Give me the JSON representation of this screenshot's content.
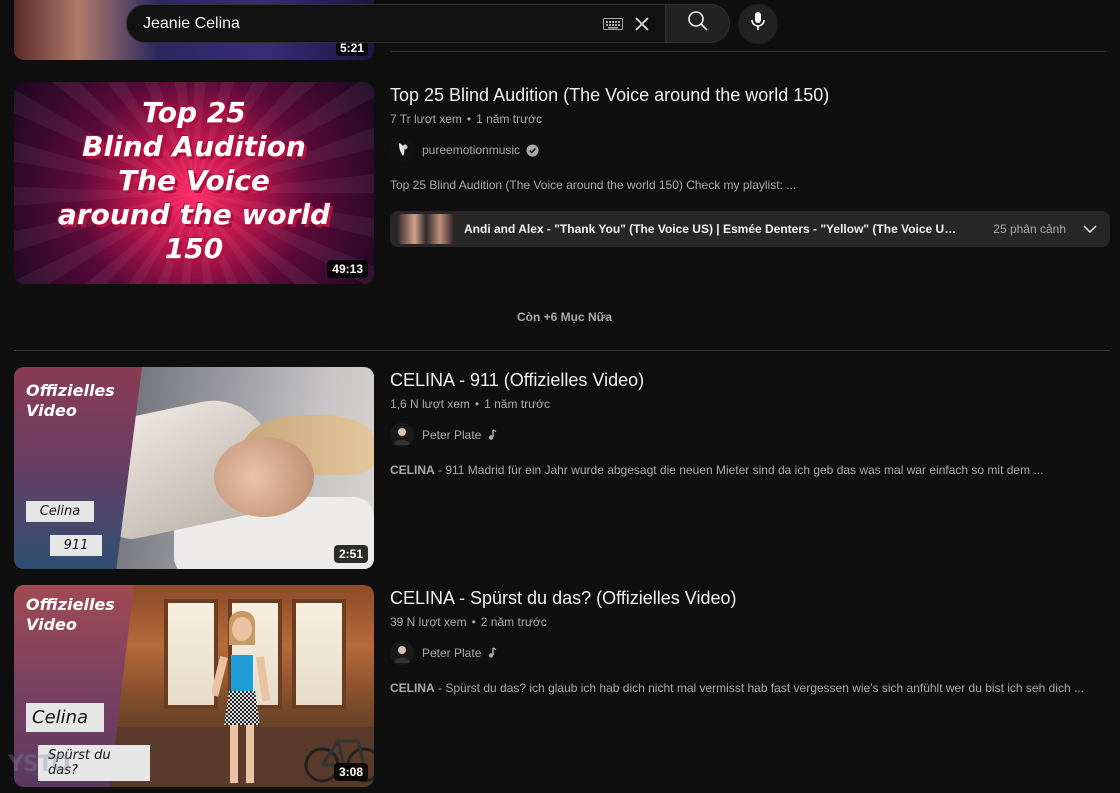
{
  "search": {
    "query": "Jeanie Celina"
  },
  "partial_item": {
    "duration": "5:21"
  },
  "videos": [
    {
      "title": "Top 25 Blind Audition (The Voice around the world 150)",
      "views": "7 Tr lượt xem",
      "age": "1 năm trước",
      "channel": "pureemotionmusic",
      "description": "Top 25 Blind Audition (The Voice around the world 150) Check my playlist: ...",
      "duration": "49:13",
      "thumb_text": [
        "Top 25",
        "Blind Audition",
        "The Voice",
        "around the world",
        "150"
      ],
      "chapters": {
        "text": "Andi and Alex - \"Thank You\" (The Voice US) | Esmée Denters - \"Yellow\" (The Voice UK) | Leen...",
        "count": "25 phân cảnh"
      }
    },
    {
      "title": "CELINA - 911 (Offizielles Video)",
      "views": "1,6 N lượt xem",
      "age": "1 năm trước",
      "channel": "Peter Plate",
      "desc_bold": "CELINA",
      "description": " - 911 Madrid für ein Jahr wurde abgesagt die neuen Mieter sind da ich geb das was mal war einfach so mit dem ...",
      "duration": "2:51",
      "thumb_label": "Offizielles\nVideo",
      "thumb_tag1": "Celina",
      "thumb_tag2": "911"
    },
    {
      "title": "CELINA - Spürst du das? (Offizielles Video)",
      "views": "39 N lượt xem",
      "age": "2 năm trước",
      "channel": "Peter Plate",
      "desc_bold": "CELINA",
      "description": " - Spürst du das? ich glaub ich hab dich nicht mal vermisst hab fast vergessen wie's sich anfühlt wer du bist ich seh dich ...",
      "duration": "3:08",
      "thumb_label": "Offizielles\nVideo",
      "thumb_tag1": "Celina",
      "thumb_tag2": "Spürst du das?"
    }
  ],
  "more": "Còn +6 Mục Nữa",
  "watermark": "YSTO"
}
